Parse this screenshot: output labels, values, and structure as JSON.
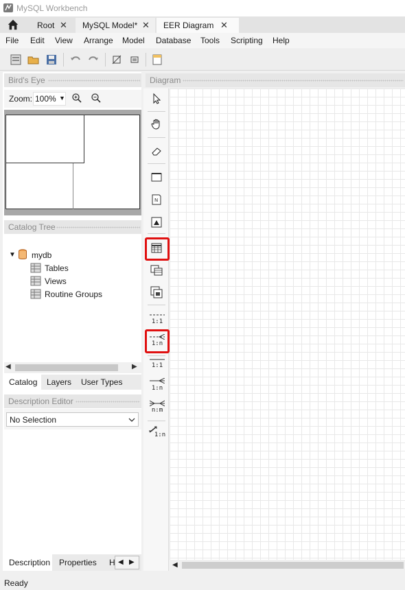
{
  "window": {
    "title": "MySQL Workbench"
  },
  "tabs": [
    {
      "label": "Root",
      "close": "✕"
    },
    {
      "label": "MySQL Model*",
      "close": "✕"
    },
    {
      "label": "EER Diagram",
      "close": "✕"
    }
  ],
  "menu": [
    "File",
    "Edit",
    "View",
    "Arrange",
    "Model",
    "Database",
    "Tools",
    "Scripting",
    "Help"
  ],
  "birds_eye": {
    "header": "Bird's Eye",
    "zoom_label": "Zoom:",
    "zoom_value": "100%"
  },
  "catalog": {
    "header": "Catalog Tree",
    "schema": "mydb",
    "children": [
      "Tables",
      "Views",
      "Routine Groups"
    ],
    "tabs": [
      "Catalog",
      "Layers",
      "User Types"
    ]
  },
  "description": {
    "header": "Description Editor",
    "select_value": "No Selection",
    "bottom_tabs": [
      "Description",
      "Properties",
      "H"
    ]
  },
  "diagram": {
    "header": "Diagram"
  },
  "relations": {
    "r1": "1:1",
    "r2": "1:n",
    "r3": "1:1",
    "r4": "1:n",
    "r5": "n:m",
    "r6": "1:n"
  },
  "status": {
    "text": "Ready"
  },
  "colors": {
    "highlight": "#e01010",
    "accent": "#3c6fb0"
  }
}
